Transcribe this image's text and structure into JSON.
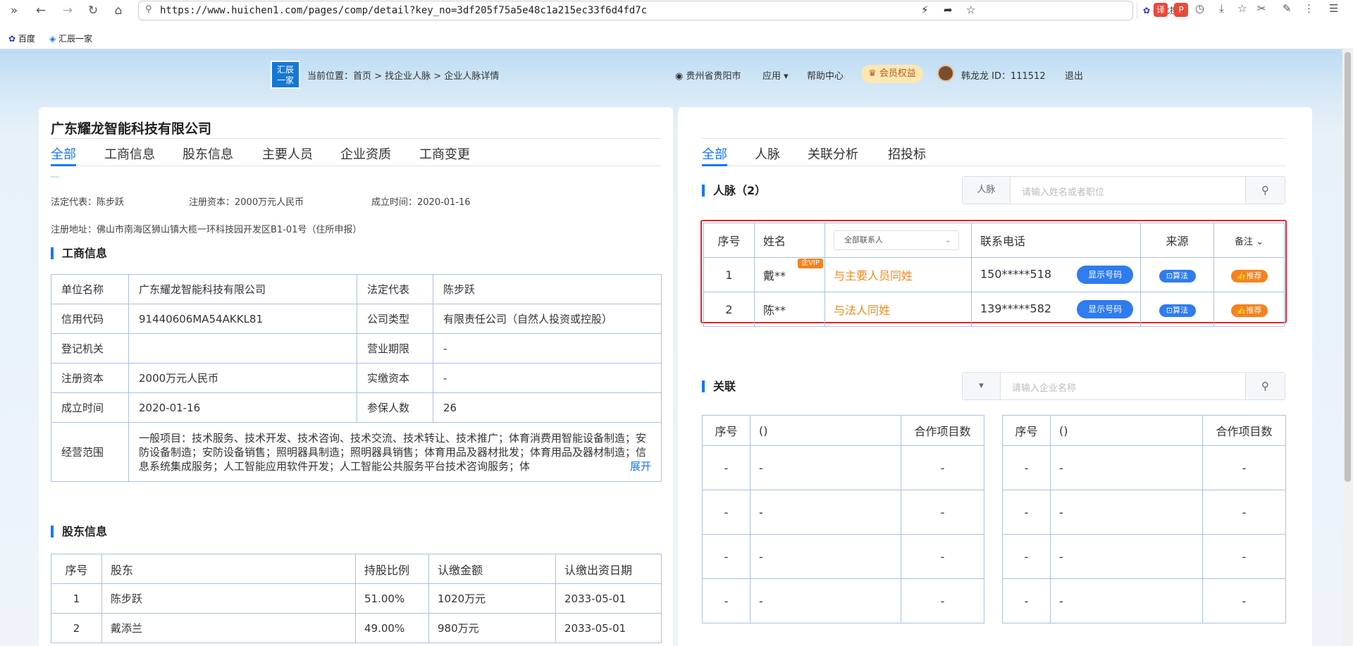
{
  "browser": {
    "url": "https://www.huichen1.com/pages/comp/detail?key_no=3df205f75a5e48c1a215ec33f6d4fd7c",
    "search_chip": "在此搜索",
    "bookmarks": [
      "百度",
      "汇辰一家"
    ]
  },
  "site": {
    "logo_text_1": "汇辰",
    "logo_text_2": "一家",
    "breadcrumb": "当前位置：首页 > 找企业人脉 > 企业人脉详情",
    "location": "贵州省贵阳市",
    "apps": "应用",
    "help": "帮助中心",
    "vip": "会员权益",
    "user": "韩龙龙 ID：111512",
    "logout": "退出"
  },
  "company": {
    "name": "广东耀龙智能科技有限公司",
    "tabs": [
      "全部",
      "工商信息",
      "股东信息",
      "主要人员",
      "企业资质",
      "工商变更"
    ],
    "legal_rep": "法定代表：陈步跃",
    "reg_capital": "注册资本：2000万元人民币",
    "founded": "成立时间：2020-01-16",
    "address": "注册地址：佛山市南海区狮山镇大榄一环科技园开发区B1-01号（住所申报）"
  },
  "business": {
    "title": "工商信息",
    "rows": [
      [
        "单位名称",
        "广东耀龙智能科技有限公司",
        "法定代表",
        "陈步跃"
      ],
      [
        "信用代码",
        "91440606MA54AKKL81",
        "公司类型",
        "有限责任公司（自然人投资或控股）"
      ],
      [
        "登记机关",
        "",
        "营业期限",
        "-"
      ],
      [
        "注册资本",
        "2000万元人民币",
        "实缴资本",
        "-"
      ],
      [
        "成立时间",
        "2020-01-16",
        "参保人数",
        "26"
      ]
    ],
    "scope_label": "经营范围",
    "scope_text": "一般项目：技术服务、技术开发、技术咨询、技术交流、技术转让、技术推广；体育消费用智能设备制造；安防设备制造；安防设备销售；照明器具制造；照明器具销售；体育用品及器材批发；体育用品及器材制造；信息系统集成服务；人工智能应用软件开发；人工智能公共服务平台技术咨询服务；体",
    "scope_more": "展开"
  },
  "shareholders": {
    "title": "股东信息",
    "headers": [
      "序号",
      "股东",
      "持股比例",
      "认缴金额",
      "认缴出资日期"
    ],
    "rows": [
      [
        "1",
        "陈步跃",
        "51.00%",
        "1020万元",
        "2033-05-01"
      ],
      [
        "2",
        "戴添兰",
        "49.00%",
        "980万元",
        "2033-05-01"
      ]
    ]
  },
  "right": {
    "tabs": [
      "全部",
      "人脉",
      "关联分析",
      "招投标"
    ],
    "contacts_title": "人脉（2）",
    "contacts_search_label": "人脉",
    "contacts_search_placeholder": "请输入姓名或者职位",
    "headers": [
      "序号",
      "姓名",
      "全部联系人",
      "联系电话",
      "来源",
      "备注"
    ],
    "contacts": [
      {
        "no": "1",
        "name": "戴**",
        "badge": "企VIP",
        "relation": "与主要人员同姓",
        "phone": "150*****518",
        "show": "显示号码",
        "source": "算法",
        "note": "推荐"
      },
      {
        "no": "2",
        "name": "陈**",
        "badge": "",
        "relation": "与法人同姓",
        "phone": "139*****582",
        "show": "显示号码",
        "source": "算法",
        "note": "推荐"
      }
    ],
    "related_title": "关联",
    "related_search_placeholder": "请输入企业名称",
    "related_headers": [
      "序号",
      "()",
      "合作项目数"
    ],
    "related_rows": [
      [
        "-",
        "-",
        "-"
      ],
      [
        "-",
        "-",
        "-"
      ],
      [
        "-",
        "-",
        "-"
      ],
      [
        "-",
        "-",
        "-"
      ]
    ]
  }
}
